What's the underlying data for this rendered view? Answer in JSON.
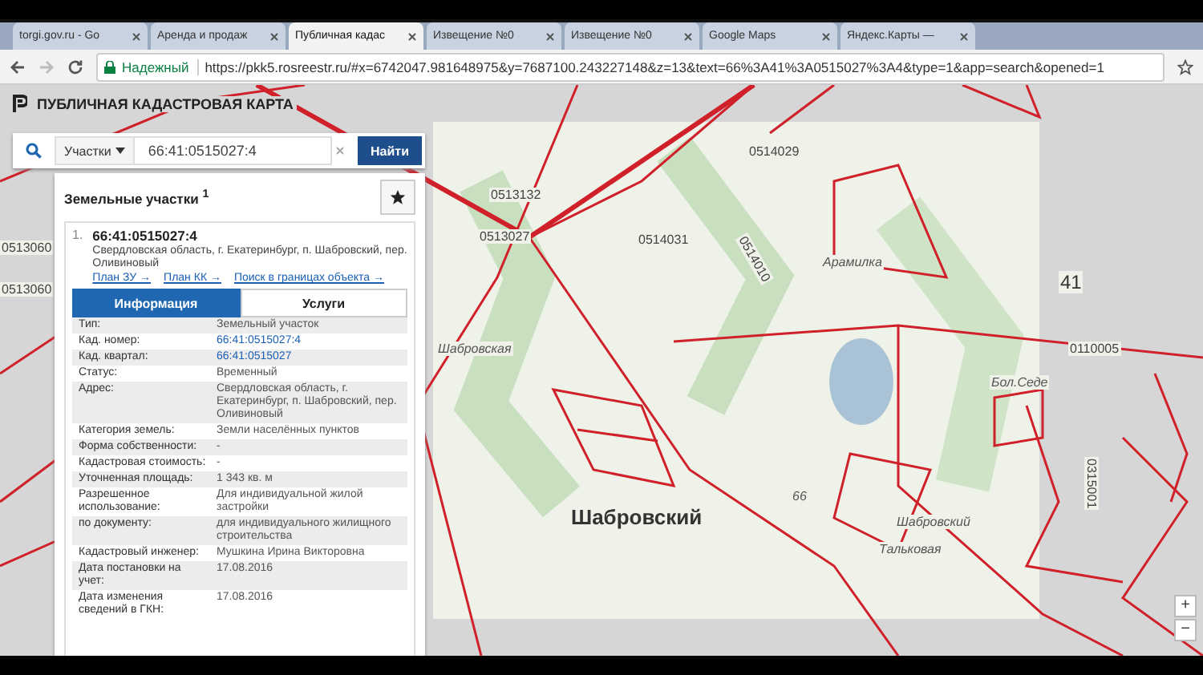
{
  "browser": {
    "tabs": [
      {
        "title": "torgi.gov.ru - Go",
        "selected": false
      },
      {
        "title": "Аренда и продаж",
        "selected": false
      },
      {
        "title": "Публичная кадас",
        "selected": true
      },
      {
        "title": "Извещение №0",
        "selected": false
      },
      {
        "title": "Извещение №0",
        "selected": false
      },
      {
        "title": "Google Maps",
        "selected": false
      },
      {
        "title": "Яндекс.Карты —",
        "selected": false
      }
    ],
    "secure_label": "Надежный",
    "url": "https://pkk5.rosreestr.ru/#x=6742047.981648975&y=7687100.243227148&z=13&text=66%3A41%3A0515027%3A4&type=1&app=search&opened=1"
  },
  "app_title": "ПУБЛИЧНАЯ КАДАСТРОВАЯ КАРТА",
  "search": {
    "category": "Участки",
    "value": "66:41:0515027:4",
    "button": "Найти"
  },
  "results": {
    "heading": "Земельные участки",
    "count": "1",
    "item": {
      "number": "1.",
      "title": "66:41:0515027:4",
      "address": "Свердловская область, г. Екатеринбург, п. Шабровский, пер. Оливиновый",
      "links": [
        "План ЗУ →",
        "План КК →",
        "Поиск в границах объекта →"
      ]
    }
  },
  "info_tabs": [
    {
      "label": "Информация",
      "selected": true
    },
    {
      "label": "Услуги",
      "selected": false
    }
  ],
  "attributes": [
    {
      "label": "Тип:",
      "value": "Земельный участок",
      "kind": "text"
    },
    {
      "label": "Кад. номер:",
      "value": "66:41:0515027:4",
      "kind": "link"
    },
    {
      "label": "Кад. квартал:",
      "value": "66:41:0515027",
      "kind": "link"
    },
    {
      "label": "Статус:",
      "value": "Временный",
      "kind": "text"
    },
    {
      "label": "Адрес:",
      "value": "Свердловская область, г. Екатеринбург, п. Шабровский, пер. Оливиновый",
      "kind": "text"
    },
    {
      "label": "Категория земель:",
      "value": "Земли населённых пунктов",
      "kind": "text"
    },
    {
      "label": "Форма собственности:",
      "value": "-",
      "kind": "text"
    },
    {
      "label": "Кадастровая стоимость:",
      "value": "-",
      "kind": "text"
    },
    {
      "label": "Уточненная площадь:",
      "value": "1 343 кв. м",
      "kind": "text"
    },
    {
      "label": "Разрешенное использование:",
      "value": "Для индивидуальной жилой застройки",
      "kind": "text"
    },
    {
      "label": "по документу:",
      "value": "для индивидуального жилищного строительства",
      "kind": "text"
    },
    {
      "label": "Кадастровый инженер:",
      "value": "Мушкина Ирина Викторовна",
      "kind": "text"
    },
    {
      "label": "Дата постановки на учет:",
      "value": "17.08.2016",
      "kind": "text"
    },
    {
      "label": "Дата изменения сведений в ГКН:",
      "value": "17.08.2016",
      "kind": "text"
    }
  ],
  "map_labels": [
    {
      "text": "0514029",
      "kind": "quarter"
    },
    {
      "text": "0513132",
      "kind": "quarter"
    },
    {
      "text": "0513027",
      "kind": "quarter"
    },
    {
      "text": "0514031",
      "kind": "quarter"
    },
    {
      "text": "0514010",
      "kind": "quarter"
    },
    {
      "text": "Арамилка",
      "kind": "place"
    },
    {
      "text": "41",
      "kind": "district"
    },
    {
      "text": "0110005",
      "kind": "quarter"
    },
    {
      "text": "Бол.Седе",
      "kind": "place"
    },
    {
      "text": "Шабровский",
      "kind": "town"
    },
    {
      "text": "Шабровская",
      "kind": "place"
    },
    {
      "text": "Шабровский",
      "kind": "place"
    },
    {
      "text": "Тальковая",
      "kind": "place"
    },
    {
      "text": "66",
      "kind": "place"
    },
    {
      "text": "0513060",
      "kind": "quarter"
    },
    {
      "text": "0513060",
      "kind": "quarter"
    },
    {
      "text": "0315001",
      "kind": "quarter"
    }
  ],
  "zoom_controls": [
    "+",
    "−"
  ]
}
